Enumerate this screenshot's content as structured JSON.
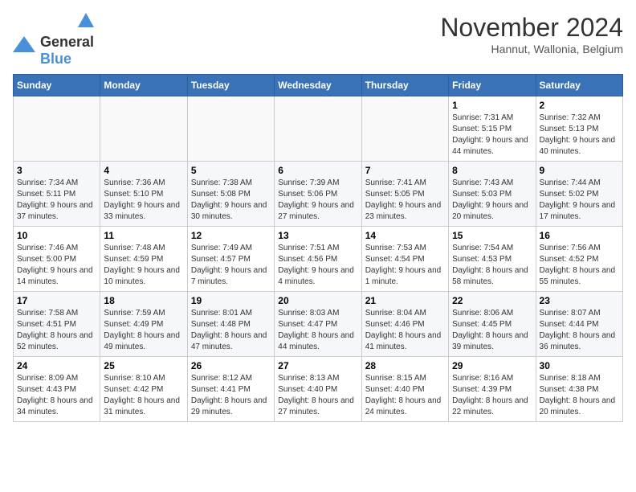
{
  "header": {
    "logo_line1": "General",
    "logo_line2": "Blue",
    "month_title": "November 2024",
    "subtitle": "Hannut, Wallonia, Belgium"
  },
  "weekdays": [
    "Sunday",
    "Monday",
    "Tuesday",
    "Wednesday",
    "Thursday",
    "Friday",
    "Saturday"
  ],
  "weeks": [
    [
      {
        "day": "",
        "info": ""
      },
      {
        "day": "",
        "info": ""
      },
      {
        "day": "",
        "info": ""
      },
      {
        "day": "",
        "info": ""
      },
      {
        "day": "",
        "info": ""
      },
      {
        "day": "1",
        "info": "Sunrise: 7:31 AM\nSunset: 5:15 PM\nDaylight: 9 hours and 44 minutes."
      },
      {
        "day": "2",
        "info": "Sunrise: 7:32 AM\nSunset: 5:13 PM\nDaylight: 9 hours and 40 minutes."
      }
    ],
    [
      {
        "day": "3",
        "info": "Sunrise: 7:34 AM\nSunset: 5:11 PM\nDaylight: 9 hours and 37 minutes."
      },
      {
        "day": "4",
        "info": "Sunrise: 7:36 AM\nSunset: 5:10 PM\nDaylight: 9 hours and 33 minutes."
      },
      {
        "day": "5",
        "info": "Sunrise: 7:38 AM\nSunset: 5:08 PM\nDaylight: 9 hours and 30 minutes."
      },
      {
        "day": "6",
        "info": "Sunrise: 7:39 AM\nSunset: 5:06 PM\nDaylight: 9 hours and 27 minutes."
      },
      {
        "day": "7",
        "info": "Sunrise: 7:41 AM\nSunset: 5:05 PM\nDaylight: 9 hours and 23 minutes."
      },
      {
        "day": "8",
        "info": "Sunrise: 7:43 AM\nSunset: 5:03 PM\nDaylight: 9 hours and 20 minutes."
      },
      {
        "day": "9",
        "info": "Sunrise: 7:44 AM\nSunset: 5:02 PM\nDaylight: 9 hours and 17 minutes."
      }
    ],
    [
      {
        "day": "10",
        "info": "Sunrise: 7:46 AM\nSunset: 5:00 PM\nDaylight: 9 hours and 14 minutes."
      },
      {
        "day": "11",
        "info": "Sunrise: 7:48 AM\nSunset: 4:59 PM\nDaylight: 9 hours and 10 minutes."
      },
      {
        "day": "12",
        "info": "Sunrise: 7:49 AM\nSunset: 4:57 PM\nDaylight: 9 hours and 7 minutes."
      },
      {
        "day": "13",
        "info": "Sunrise: 7:51 AM\nSunset: 4:56 PM\nDaylight: 9 hours and 4 minutes."
      },
      {
        "day": "14",
        "info": "Sunrise: 7:53 AM\nSunset: 4:54 PM\nDaylight: 9 hours and 1 minute."
      },
      {
        "day": "15",
        "info": "Sunrise: 7:54 AM\nSunset: 4:53 PM\nDaylight: 8 hours and 58 minutes."
      },
      {
        "day": "16",
        "info": "Sunrise: 7:56 AM\nSunset: 4:52 PM\nDaylight: 8 hours and 55 minutes."
      }
    ],
    [
      {
        "day": "17",
        "info": "Sunrise: 7:58 AM\nSunset: 4:51 PM\nDaylight: 8 hours and 52 minutes."
      },
      {
        "day": "18",
        "info": "Sunrise: 7:59 AM\nSunset: 4:49 PM\nDaylight: 8 hours and 49 minutes."
      },
      {
        "day": "19",
        "info": "Sunrise: 8:01 AM\nSunset: 4:48 PM\nDaylight: 8 hours and 47 minutes."
      },
      {
        "day": "20",
        "info": "Sunrise: 8:03 AM\nSunset: 4:47 PM\nDaylight: 8 hours and 44 minutes."
      },
      {
        "day": "21",
        "info": "Sunrise: 8:04 AM\nSunset: 4:46 PM\nDaylight: 8 hours and 41 minutes."
      },
      {
        "day": "22",
        "info": "Sunrise: 8:06 AM\nSunset: 4:45 PM\nDaylight: 8 hours and 39 minutes."
      },
      {
        "day": "23",
        "info": "Sunrise: 8:07 AM\nSunset: 4:44 PM\nDaylight: 8 hours and 36 minutes."
      }
    ],
    [
      {
        "day": "24",
        "info": "Sunrise: 8:09 AM\nSunset: 4:43 PM\nDaylight: 8 hours and 34 minutes."
      },
      {
        "day": "25",
        "info": "Sunrise: 8:10 AM\nSunset: 4:42 PM\nDaylight: 8 hours and 31 minutes."
      },
      {
        "day": "26",
        "info": "Sunrise: 8:12 AM\nSunset: 4:41 PM\nDaylight: 8 hours and 29 minutes."
      },
      {
        "day": "27",
        "info": "Sunrise: 8:13 AM\nSunset: 4:40 PM\nDaylight: 8 hours and 27 minutes."
      },
      {
        "day": "28",
        "info": "Sunrise: 8:15 AM\nSunset: 4:40 PM\nDaylight: 8 hours and 24 minutes."
      },
      {
        "day": "29",
        "info": "Sunrise: 8:16 AM\nSunset: 4:39 PM\nDaylight: 8 hours and 22 minutes."
      },
      {
        "day": "30",
        "info": "Sunrise: 8:18 AM\nSunset: 4:38 PM\nDaylight: 8 hours and 20 minutes."
      }
    ]
  ]
}
